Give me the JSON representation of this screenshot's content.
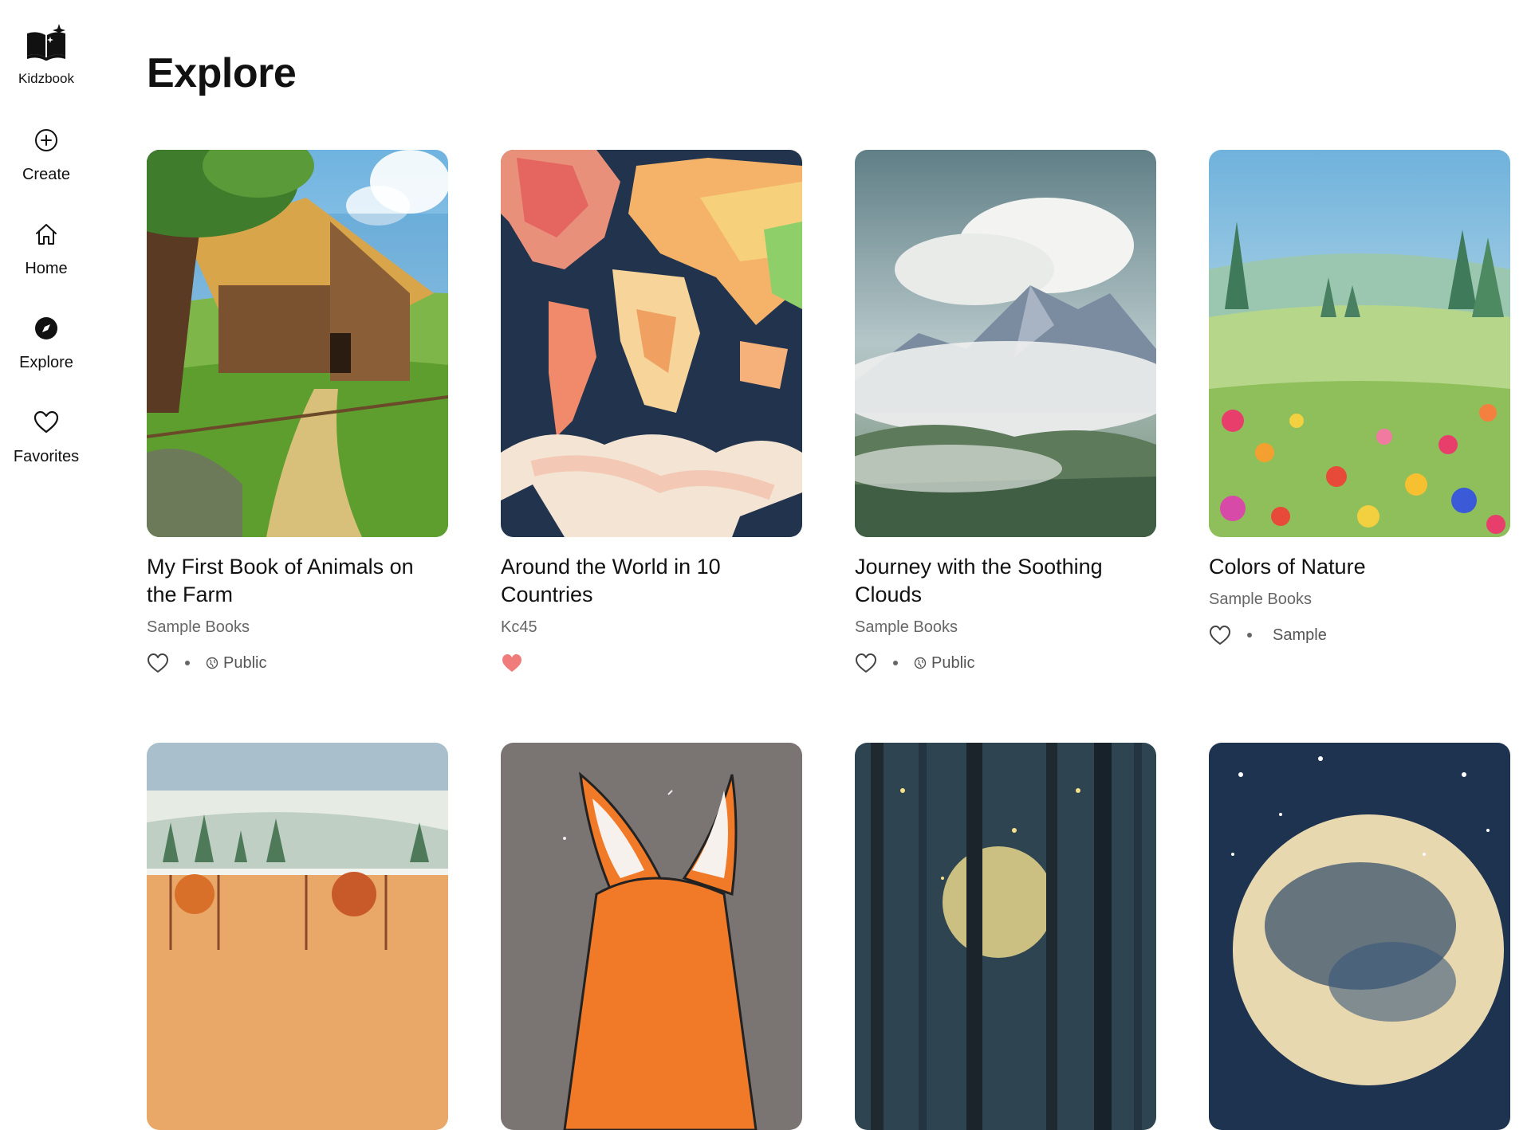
{
  "app": {
    "name": "Kidzbook"
  },
  "nav": {
    "items": [
      {
        "label": "Create",
        "icon": "plus-circle-icon"
      },
      {
        "label": "Home",
        "icon": "home-icon"
      },
      {
        "label": "Explore",
        "icon": "compass-icon"
      },
      {
        "label": "Favorites",
        "icon": "heart-icon"
      }
    ]
  },
  "page": {
    "title": "Explore"
  },
  "books": [
    {
      "title": "My First Book of Animals on the Farm",
      "author": "Sample Books",
      "favorited": false,
      "visibility": "Public",
      "cover": "farm-barn-illustration"
    },
    {
      "title": "Around the World in 10 Countries",
      "author": "Kc45",
      "favorited": true,
      "visibility": "",
      "cover": "world-map-watercolor"
    },
    {
      "title": "Journey with the Soothing Clouds",
      "author": "Sample Books",
      "favorited": false,
      "visibility": "Public",
      "cover": "mountain-clouds-watercolor"
    },
    {
      "title": "Colors of Nature",
      "author": "Sample Books",
      "favorited": false,
      "visibility": "Sample",
      "cover": "flower-meadow-watercolor"
    },
    {
      "title": "",
      "author": "",
      "cover": "misty-forest-watercolor"
    },
    {
      "title": "",
      "author": "",
      "cover": "fox-illustration"
    },
    {
      "title": "",
      "author": "",
      "cover": "night-forest-moon-watercolor"
    },
    {
      "title": "",
      "author": "",
      "cover": "starry-moon-watercolor"
    }
  ],
  "colors": {
    "favorite": "#ef7b7b",
    "text": "#111111",
    "muted": "#666666"
  }
}
